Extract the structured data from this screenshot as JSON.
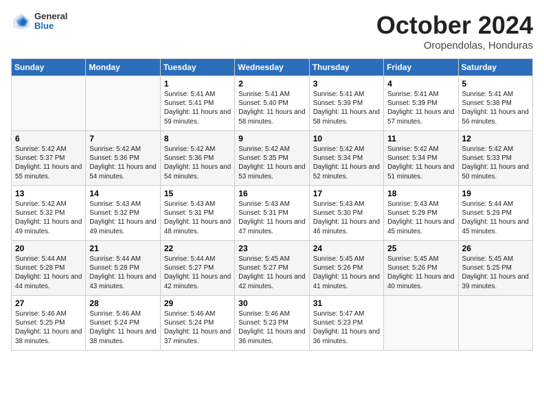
{
  "header": {
    "logo": {
      "general": "General",
      "blue": "Blue"
    },
    "title": "October 2024",
    "location": "Oropendolas, Honduras"
  },
  "weekdays": [
    "Sunday",
    "Monday",
    "Tuesday",
    "Wednesday",
    "Thursday",
    "Friday",
    "Saturday"
  ],
  "weeks": [
    [
      null,
      null,
      {
        "day": 1,
        "sunrise": "5:41 AM",
        "sunset": "5:41 PM",
        "daylight": "11 hours and 59 minutes."
      },
      {
        "day": 2,
        "sunrise": "5:41 AM",
        "sunset": "5:40 PM",
        "daylight": "11 hours and 58 minutes."
      },
      {
        "day": 3,
        "sunrise": "5:41 AM",
        "sunset": "5:39 PM",
        "daylight": "11 hours and 58 minutes."
      },
      {
        "day": 4,
        "sunrise": "5:41 AM",
        "sunset": "5:39 PM",
        "daylight": "11 hours and 57 minutes."
      },
      {
        "day": 5,
        "sunrise": "5:41 AM",
        "sunset": "5:38 PM",
        "daylight": "11 hours and 56 minutes."
      }
    ],
    [
      {
        "day": 6,
        "sunrise": "5:42 AM",
        "sunset": "5:37 PM",
        "daylight": "11 hours and 55 minutes."
      },
      {
        "day": 7,
        "sunrise": "5:42 AM",
        "sunset": "5:36 PM",
        "daylight": "11 hours and 54 minutes."
      },
      {
        "day": 8,
        "sunrise": "5:42 AM",
        "sunset": "5:36 PM",
        "daylight": "11 hours and 54 minutes."
      },
      {
        "day": 9,
        "sunrise": "5:42 AM",
        "sunset": "5:35 PM",
        "daylight": "11 hours and 53 minutes."
      },
      {
        "day": 10,
        "sunrise": "5:42 AM",
        "sunset": "5:34 PM",
        "daylight": "11 hours and 52 minutes."
      },
      {
        "day": 11,
        "sunrise": "5:42 AM",
        "sunset": "5:34 PM",
        "daylight": "11 hours and 51 minutes."
      },
      {
        "day": 12,
        "sunrise": "5:42 AM",
        "sunset": "5:33 PM",
        "daylight": "11 hours and 50 minutes."
      }
    ],
    [
      {
        "day": 13,
        "sunrise": "5:42 AM",
        "sunset": "5:32 PM",
        "daylight": "11 hours and 49 minutes."
      },
      {
        "day": 14,
        "sunrise": "5:43 AM",
        "sunset": "5:32 PM",
        "daylight": "11 hours and 49 minutes."
      },
      {
        "day": 15,
        "sunrise": "5:43 AM",
        "sunset": "5:31 PM",
        "daylight": "11 hours and 48 minutes."
      },
      {
        "day": 16,
        "sunrise": "5:43 AM",
        "sunset": "5:31 PM",
        "daylight": "11 hours and 47 minutes."
      },
      {
        "day": 17,
        "sunrise": "5:43 AM",
        "sunset": "5:30 PM",
        "daylight": "11 hours and 46 minutes."
      },
      {
        "day": 18,
        "sunrise": "5:43 AM",
        "sunset": "5:29 PM",
        "daylight": "11 hours and 45 minutes."
      },
      {
        "day": 19,
        "sunrise": "5:44 AM",
        "sunset": "5:29 PM",
        "daylight": "11 hours and 45 minutes."
      }
    ],
    [
      {
        "day": 20,
        "sunrise": "5:44 AM",
        "sunset": "5:28 PM",
        "daylight": "11 hours and 44 minutes."
      },
      {
        "day": 21,
        "sunrise": "5:44 AM",
        "sunset": "5:28 PM",
        "daylight": "11 hours and 43 minutes."
      },
      {
        "day": 22,
        "sunrise": "5:44 AM",
        "sunset": "5:27 PM",
        "daylight": "11 hours and 42 minutes."
      },
      {
        "day": 23,
        "sunrise": "5:45 AM",
        "sunset": "5:27 PM",
        "daylight": "11 hours and 42 minutes."
      },
      {
        "day": 24,
        "sunrise": "5:45 AM",
        "sunset": "5:26 PM",
        "daylight": "11 hours and 41 minutes."
      },
      {
        "day": 25,
        "sunrise": "5:45 AM",
        "sunset": "5:26 PM",
        "daylight": "11 hours and 40 minutes."
      },
      {
        "day": 26,
        "sunrise": "5:45 AM",
        "sunset": "5:25 PM",
        "daylight": "11 hours and 39 minutes."
      }
    ],
    [
      {
        "day": 27,
        "sunrise": "5:46 AM",
        "sunset": "5:25 PM",
        "daylight": "11 hours and 38 minutes."
      },
      {
        "day": 28,
        "sunrise": "5:46 AM",
        "sunset": "5:24 PM",
        "daylight": "11 hours and 38 minutes."
      },
      {
        "day": 29,
        "sunrise": "5:46 AM",
        "sunset": "5:24 PM",
        "daylight": "11 hours and 37 minutes."
      },
      {
        "day": 30,
        "sunrise": "5:46 AM",
        "sunset": "5:23 PM",
        "daylight": "11 hours and 36 minutes."
      },
      {
        "day": 31,
        "sunrise": "5:47 AM",
        "sunset": "5:23 PM",
        "daylight": "11 hours and 36 minutes."
      },
      null,
      null
    ]
  ]
}
